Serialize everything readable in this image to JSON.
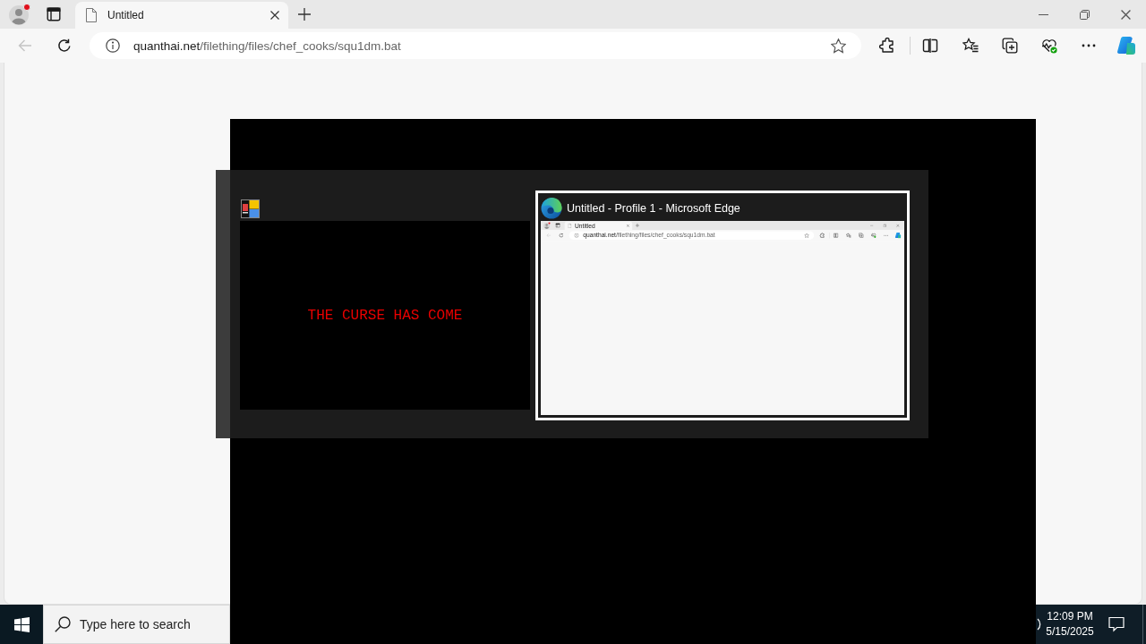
{
  "browser": {
    "tabs": [
      {
        "title": "Untitled",
        "selected": true
      }
    ],
    "back_button": {
      "disabled": true
    },
    "address_bar": {
      "domain": "quanthai.net",
      "path": "/filething/files/chef_cooks/squ1dm.bat"
    }
  },
  "task_switcher": {
    "items": [
      {
        "kind": "console",
        "caption": "THE CURSE HAS COME",
        "selected": false
      },
      {
        "kind": "browser",
        "title": "Untitled - Profile 1 - Microsoft Edge",
        "selected": true,
        "preview": {
          "tabs": [
            {
              "title": "Untitled",
              "selected": true
            }
          ],
          "back_button": {
            "disabled": true
          },
          "address_bar": {
            "domain": "quanthai.net",
            "path": "/filething/files/chef_cooks/squ1dm.bat"
          }
        }
      }
    ]
  },
  "taskbar": {
    "search": {
      "placeholder": "Type here to search"
    },
    "time": "12:09 PM",
    "date": "5/15/2025"
  }
}
